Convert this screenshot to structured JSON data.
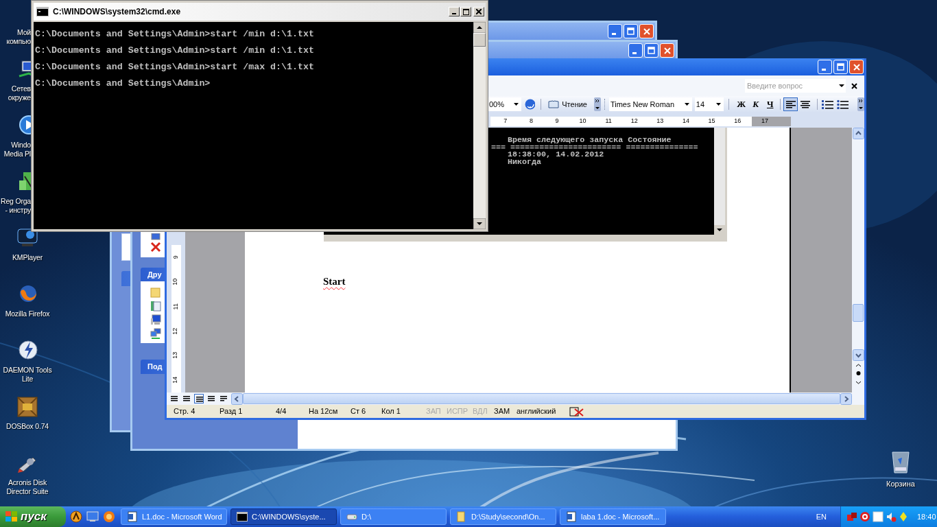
{
  "desktop_icons": [
    {
      "kind": "computer",
      "clipped": true,
      "label": [
        "Мой",
        "компью"
      ]
    },
    {
      "kind": "network",
      "clipped": true,
      "label": [
        "Сетев",
        "окруже"
      ]
    },
    {
      "kind": "media",
      "clipped": true,
      "label": [
        "Windo",
        "Media Pl"
      ]
    },
    {
      "kind": "registry",
      "clipped": true,
      "label": [
        "Reg Orga",
        "- инстру"
      ]
    },
    {
      "kind": "player",
      "clipped": false,
      "label": [
        "KMPlayer"
      ]
    },
    {
      "kind": "browser",
      "clipped": false,
      "label": [
        "Mozilla Firefox"
      ]
    },
    {
      "kind": "disc",
      "clipped": false,
      "label": [
        "DAEMON Tools",
        "Lite"
      ]
    },
    {
      "kind": "dosbox",
      "clipped": false,
      "label": [
        "DOSBox 0.74"
      ]
    },
    {
      "kind": "disk",
      "clipped": false,
      "label": [
        "Acronis Disk",
        "Director Suite"
      ]
    }
  ],
  "recycle_bin": {
    "label": "Корзина"
  },
  "explorer_window": {
    "task_headers": [
      "Дру",
      "Под"
    ]
  },
  "word": {
    "help_field": {
      "placeholder": "Введите вопрос"
    },
    "zoom": "00%",
    "reading_button": "Чтение",
    "font": "Times New Roman",
    "size": "14",
    "format_buttons": [
      {
        "kind": "bold",
        "label": "Ж"
      },
      {
        "kind": "italic",
        "label": "К"
      },
      {
        "kind": "underline",
        "label": "Ч"
      }
    ],
    "align_buttons": [
      {
        "kind": "left",
        "selected": true
      },
      {
        "kind": "center",
        "selected": false
      }
    ],
    "ruler": [
      "7",
      "8",
      "9",
      "10",
      "11",
      "12",
      "13",
      "14",
      "15",
      "16",
      "17"
    ],
    "vertical_ruler": [
      "9",
      "10",
      "11",
      "12",
      "13",
      "14"
    ],
    "console_image": {
      "lines": [
        {
          "kind": "text",
          "text": "Время следующего запуска Состояние"
        },
        {
          "kind": "rule",
          "text": "=== ======================= ==============="
        },
        {
          "kind": "text",
          "text": "18:38:00, 14.02.2012"
        },
        {
          "kind": "text",
          "text": "Никогда"
        }
      ]
    },
    "body_text": "Start",
    "status_bar": [
      {
        "text": "Стр. 4",
        "disabled": false
      },
      {
        "text": "Разд 1",
        "disabled": false
      },
      {
        "text": "4/4",
        "disabled": false
      },
      {
        "text": "На 12см",
        "disabled": false
      },
      {
        "text": "Ст 6",
        "disabled": false
      },
      {
        "text": "Кол 1",
        "disabled": false
      },
      {
        "text": "ЗАП",
        "disabled": true
      },
      {
        "text": "ИСПР",
        "disabled": true
      },
      {
        "text": "ВДЛ",
        "disabled": true
      },
      {
        "text": "ЗАМ",
        "disabled": false
      },
      {
        "text": "английский",
        "disabled": false
      }
    ]
  },
  "cmd": {
    "title": "C:\\WINDOWS\\system32\\cmd.exe",
    "lines": [
      "C:\\Documents and Settings\\Admin>start /min d:\\1.txt",
      "C:\\Documents and Settings\\Admin>start /min d:\\1.txt",
      "C:\\Documents and Settings\\Admin>start /max d:\\1.txt",
      "C:\\Documents and Settings\\Admin>"
    ]
  },
  "taskbar": {
    "start": "пуск",
    "tasks": [
      {
        "kind": "word",
        "label": "L1.doc - Microsoft Word",
        "selected": false
      },
      {
        "kind": "console",
        "label": "C:\\WINDOWS\\syste...",
        "selected": true
      },
      {
        "kind": "drive",
        "label": "D:\\",
        "selected": false
      },
      {
        "kind": "folder",
        "label": "D:\\Study\\second\\On...",
        "selected": false
      },
      {
        "kind": "word",
        "label": "laba 1.doc - Microsoft...",
        "selected": false
      }
    ],
    "language": "EN",
    "clock": "18:40"
  }
}
